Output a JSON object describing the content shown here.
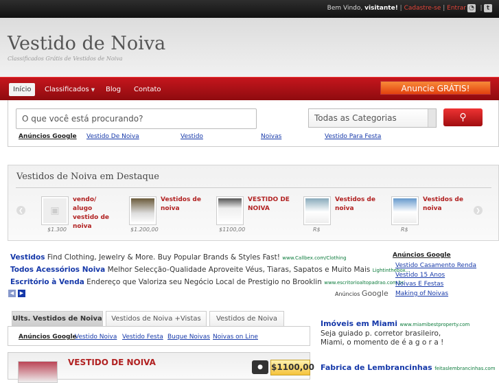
{
  "topbar": {
    "welcome": "Bem Vindo,",
    "visitor": "visitante!",
    "signup": "Cadastre-se",
    "separator": "|",
    "login": "Entrar",
    "rss_icon": "rss-icon",
    "twitter_icon": "twitter-icon",
    "twitter_glyph": "t"
  },
  "header": {
    "title": "Vestido de Noiva",
    "subtitle": "Classificados Grátis de Vestidos de Noiva"
  },
  "nav": {
    "items": [
      "Início",
      "Classificados",
      "Blog",
      "Contato"
    ],
    "cta": "Anuncie GRÁTIS!"
  },
  "search": {
    "placeholder": "O que você está procurando?",
    "category": "Todas as Categorias"
  },
  "adlinks": {
    "label": "Anúncios Google",
    "links": [
      "Vestido De Noiva",
      "Vestido",
      "Noivas",
      "Vestido Para Festa"
    ]
  },
  "featured": {
    "title": "Vestidos de Noiva em Destaque",
    "items": [
      {
        "title": "vendo/ alugo vestido de noiva",
        "price": "$1.300"
      },
      {
        "title": "Vestidos de noiva",
        "price": "$1.200,00"
      },
      {
        "title": "VESTIDO DE NOIVA",
        "price": "$1100,00"
      },
      {
        "title": "Vestidos de noiva",
        "price": "R$"
      },
      {
        "title": "Vestidos de noiva",
        "price": "R$"
      }
    ]
  },
  "ads": [
    {
      "title": "Vestidos",
      "text": "Find Clothing, Jewelry & More. Buy Popular Brands & Styles Fast!",
      "url": "www.Callbex.com/Clothing"
    },
    {
      "title": "Todos Acessórios Noiva",
      "text": "Melhor Selecção-Qualidade Aproveite Véus, Tiaras, Sapatos e Muito Mais",
      "url": "Lightinthebox..."
    },
    {
      "title": "Escritório à Venda",
      "text": "Endereço que Valoriza seu Negócio Local de Prestigio no Brooklin",
      "url": "www.escritorioaltopadrao.com.br"
    }
  ],
  "ads_footer": {
    "prefix": "Anúncios",
    "brand": "Google"
  },
  "right_links": {
    "label": "Anúncios Google",
    "links": [
      "Vestido Casamento Renda",
      "Vestido 15 Anos",
      "Noivas E Festas",
      "Making of Noivas"
    ]
  },
  "tabs": [
    "Ults. Vestidos de Noiva",
    "Vestidos de Noiva +Vistas",
    "Vestidos de Noiva"
  ],
  "panel_links": {
    "label": "Anúncios Google",
    "links": [
      "Vestido Noiva",
      "Vestido Festa",
      "Buque Noivas",
      "Noivas on Line"
    ]
  },
  "listing": {
    "title": "VESTIDO DE NOIVA",
    "price": "$1100,00"
  },
  "side_ads": [
    {
      "title": "Imóveis em Miami",
      "url": "www.miamibestproperty.com",
      "text": "Seja guiado p. corretor brasileiro, Miami, o momento de é a g o r a !"
    },
    {
      "title": "Fabrica de Lembrancinhas",
      "url": "feitaslembrancinhas.com"
    }
  ],
  "colors": {
    "brand_red": "#b3131a",
    "cta_orange": "#f06a20",
    "link_blue": "#1538a9"
  }
}
